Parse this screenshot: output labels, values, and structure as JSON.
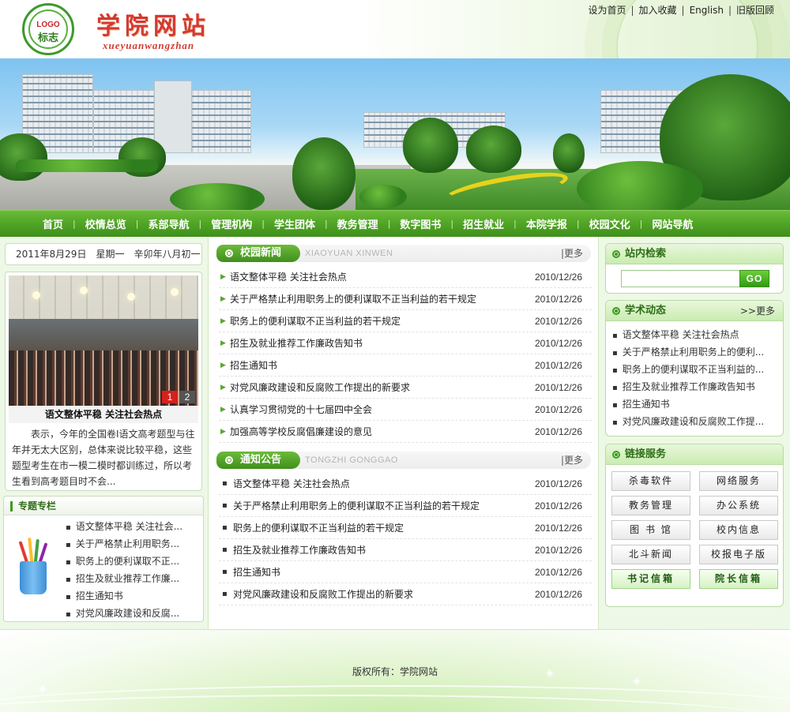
{
  "header": {
    "logo_en": "LOGO",
    "logo_cn": "标志",
    "site_title": "学院网站",
    "site_subtitle": "xueyuanwangzhan",
    "top_links": [
      "设为首页",
      "加入收藏",
      "English",
      "旧版回顾"
    ]
  },
  "nav": {
    "items": [
      "首页",
      "校情总览",
      "系部导航",
      "管理机构",
      "学生团体",
      "教务管理",
      "数字图书",
      "招生就业",
      "本院学报",
      "校园文化",
      "网站导航"
    ]
  },
  "left": {
    "date": "2011年8月29日　星期一　辛卯年八月初一",
    "photo": {
      "pages": [
        "1",
        "2"
      ],
      "title": "语文整体平稳 关注社会热点",
      "desc": "表示，今年的全国卷Ⅰ语文高考题型与往年并无太大区别，总体来说比较平稳，这些题型考生在市一模二模时都训练过，所以考生看到高考题目时不会..."
    },
    "special": {
      "title": "专题专栏",
      "items": [
        "语文整体平稳 关注社会...",
        "关于严格禁止利用职务...",
        "职务上的便利谋取不正...",
        "招生及就业推荐工作廉...",
        "招生通知书",
        "对党风廉政建设和反腐..."
      ]
    }
  },
  "news": {
    "title": "校园新闻",
    "pinyin": "XIAOYUAN XINWEN",
    "more": "|更多",
    "items": [
      {
        "title": "语文整体平稳 关注社会热点",
        "date": "2010/12/26"
      },
      {
        "title": "关于严格禁止利用职务上的便利谋取不正当利益的若干规定",
        "date": "2010/12/26"
      },
      {
        "title": "职务上的便利谋取不正当利益的若干规定",
        "date": "2010/12/26"
      },
      {
        "title": "招生及就业推荐工作廉政告知书",
        "date": "2010/12/26"
      },
      {
        "title": "招生通知书",
        "date": "2010/12/26"
      },
      {
        "title": "对党风廉政建设和反腐败工作提出的新要求",
        "date": "2010/12/26"
      },
      {
        "title": "认真学习贯彻党的十七届四中全会",
        "date": "2010/12/26"
      },
      {
        "title": "加强高等学校反腐倡廉建设的意见",
        "date": "2010/12/26"
      }
    ]
  },
  "notice": {
    "title": "通知公告",
    "pinyin": "TONGZHI GONGGAO",
    "more": "|更多",
    "items": [
      {
        "title": "语文整体平稳 关注社会热点",
        "date": "2010/12/26"
      },
      {
        "title": "关于严格禁止利用职务上的便利谋取不正当利益的若干规定",
        "date": "2010/12/26"
      },
      {
        "title": "职务上的便利谋取不正当利益的若干规定",
        "date": "2010/12/26"
      },
      {
        "title": "招生及就业推荐工作廉政告知书",
        "date": "2010/12/26"
      },
      {
        "title": "招生通知书",
        "date": "2010/12/26"
      },
      {
        "title": "对党风廉政建设和反腐败工作提出的新要求",
        "date": "2010/12/26"
      }
    ]
  },
  "right": {
    "search": {
      "title": "站内检索",
      "button": "GO",
      "value": ""
    },
    "academic": {
      "title": "学术动态",
      "more": ">>更多",
      "items": [
        "语文整体平稳 关注社会热点",
        "关于严格禁止利用职务上的便利...",
        "职务上的便利谋取不正当利益的...",
        "招生及就业推荐工作廉政告知书",
        "招生通知书",
        "对党风廉政建设和反腐败工作提..."
      ]
    },
    "links": {
      "title": "链接服务",
      "items": [
        "杀毒软件",
        "网络服务",
        "教务管理",
        "办公系统",
        "图 书 馆",
        "校内信息",
        "北斗新闻",
        "校报电子版",
        "书记信箱",
        "院长信箱"
      ]
    }
  },
  "footer": {
    "copyright": "版权所有：学院网站"
  },
  "colors": {
    "brand_green": "#4da223",
    "title_red": "#d43a2f",
    "pager_active": "#d6201c"
  }
}
